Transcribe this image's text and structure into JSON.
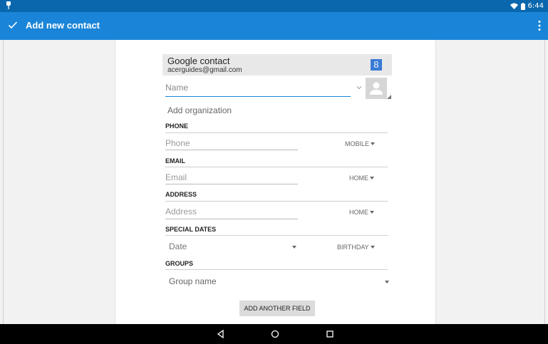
{
  "status_bar": {
    "time": "6:44",
    "icons": [
      "notification-icon",
      "wifi-icon",
      "battery-icon"
    ]
  },
  "app_bar": {
    "title": "Add new contact",
    "confirm_icon": "check-icon",
    "menu_icon": "overflow-menu-icon"
  },
  "account": {
    "title": "Google contact",
    "email": "acerguides@gmail.com",
    "icon": "google-icon",
    "icon_glyph": "8"
  },
  "name_field": {
    "placeholder": "Name"
  },
  "organization": {
    "label": "Add organization"
  },
  "sections": {
    "phone": {
      "label": "PHONE",
      "placeholder": "Phone",
      "type": "MOBILE"
    },
    "email": {
      "label": "EMAIL",
      "placeholder": "Email",
      "type": "HOME"
    },
    "address": {
      "label": "ADDRESS",
      "placeholder": "Address",
      "type": "HOME"
    },
    "special_dates": {
      "label": "SPECIAL DATES",
      "placeholder": "Date",
      "type": "BIRTHDAY"
    },
    "groups": {
      "label": "GROUPS",
      "placeholder": "Group name"
    }
  },
  "add_field_button": "ADD ANOTHER FIELD",
  "nav_bar": [
    "back-icon",
    "home-icon",
    "recents-icon"
  ],
  "colors": {
    "status_bar": "#0b67ad",
    "app_bar": "#1a85d8",
    "accent": "#1a85d8",
    "google_icon": "#3a7bd5"
  }
}
